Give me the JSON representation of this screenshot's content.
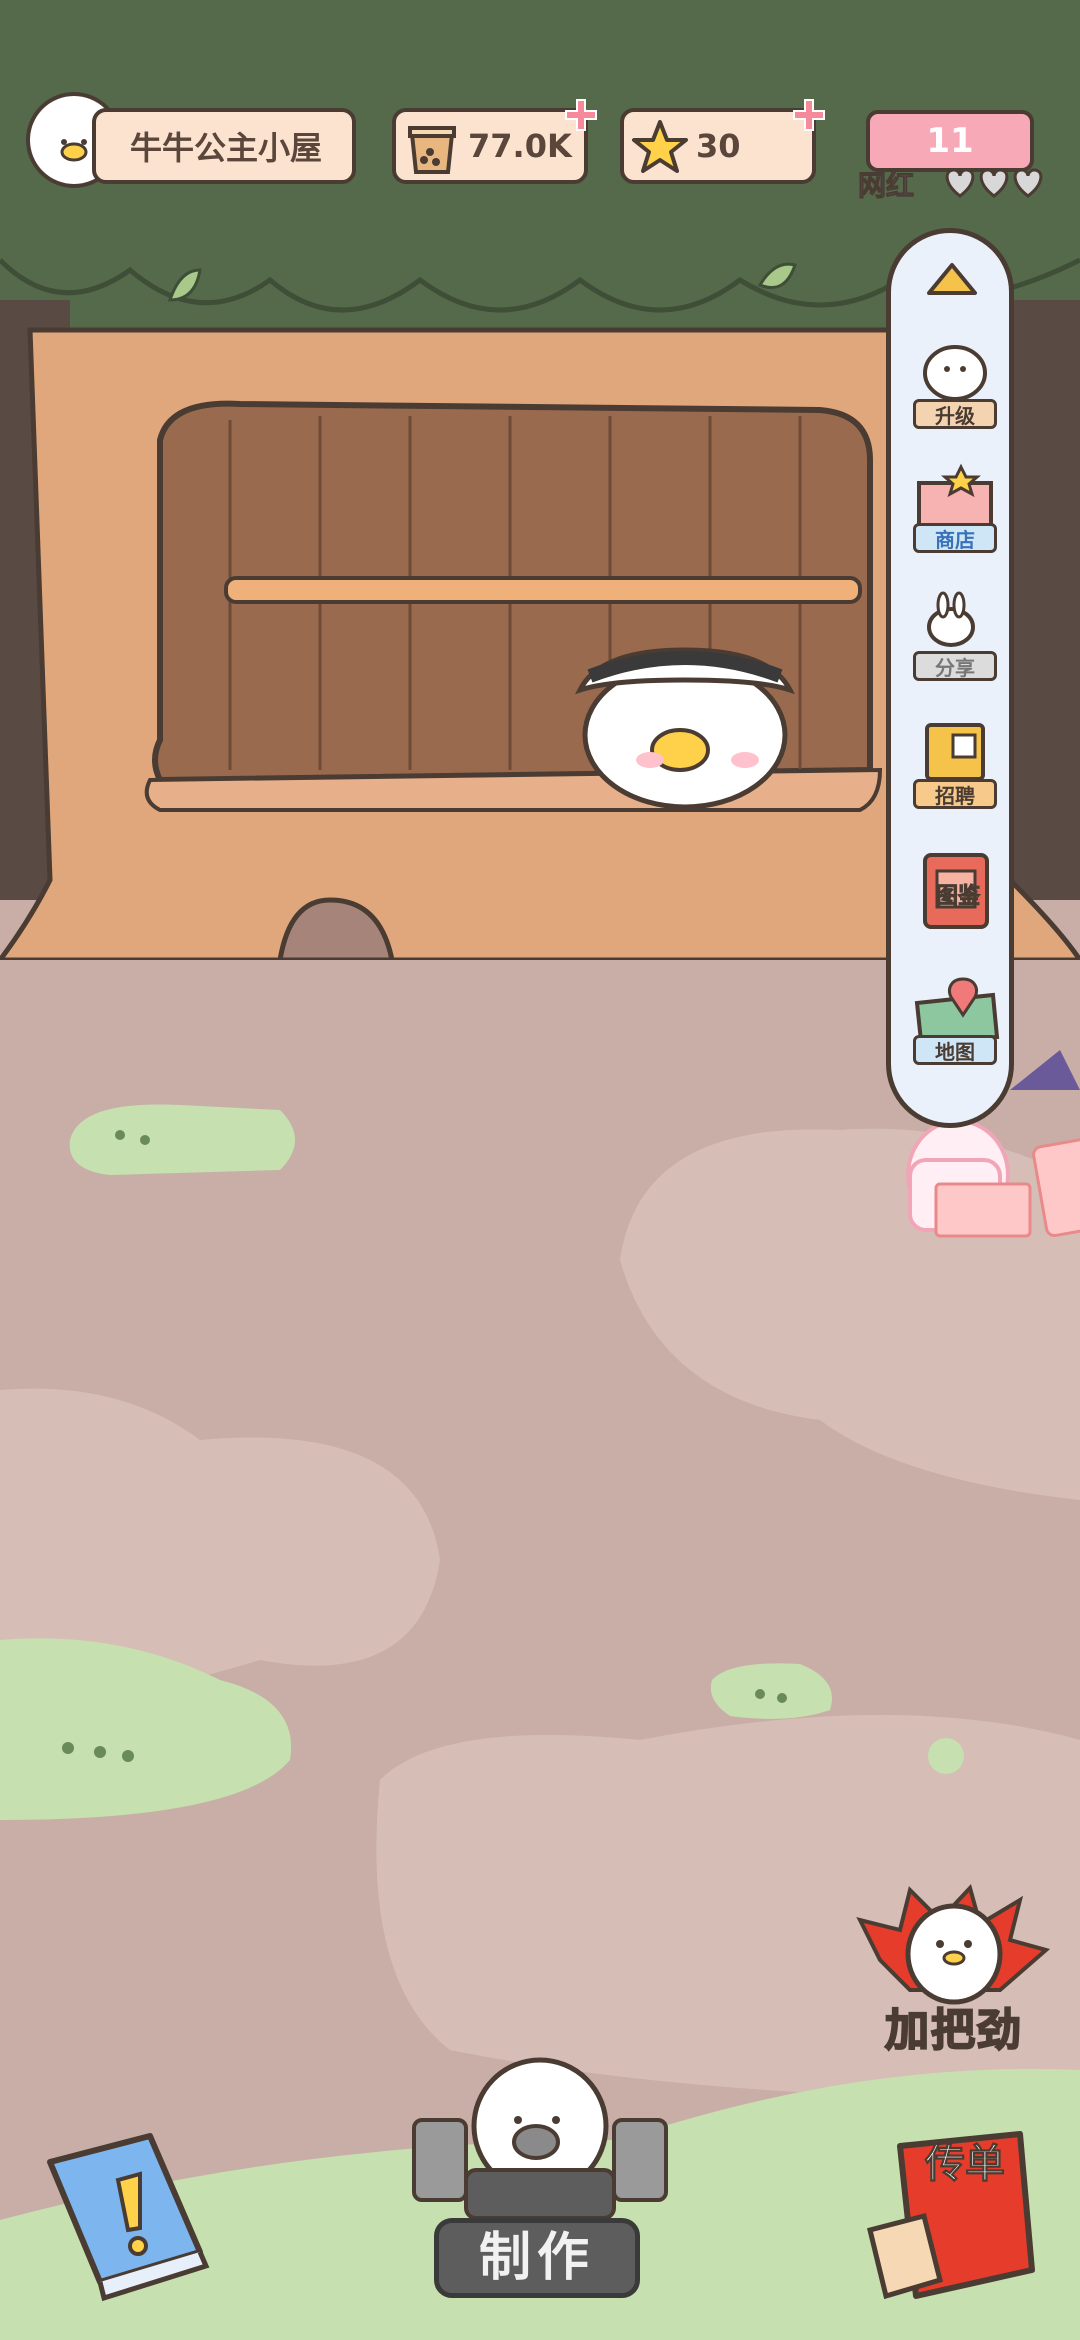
{
  "hud": {
    "shop_name": "牛牛公主小屋",
    "tea_count": "77.0K",
    "star_count": "30",
    "energy_count": "11",
    "energy_label": "网红"
  },
  "side_menu": {
    "items": [
      {
        "label": "升级",
        "icon": "duck-upgrade-icon"
      },
      {
        "label": "商店",
        "icon": "shop-icon"
      },
      {
        "label": "分享",
        "icon": "rabbit-share-icon"
      },
      {
        "label": "招聘",
        "icon": "recruit-poster-icon"
      },
      {
        "label": "图鉴",
        "icon": "book-collection-icon"
      },
      {
        "label": "地图",
        "icon": "map-pin-icon"
      }
    ]
  },
  "bottom": {
    "make_label": "制作",
    "cheer_label": "加把劲",
    "flyer_label": "传单"
  },
  "colors": {
    "forest": "#55694b",
    "trunk": "#e0a77c",
    "ground": "#c8aea7",
    "grass": "#c6e0b0",
    "outline": "#4a3c32",
    "accent_red": "#e53c2c",
    "accent_pink": "#f7a9b8"
  }
}
